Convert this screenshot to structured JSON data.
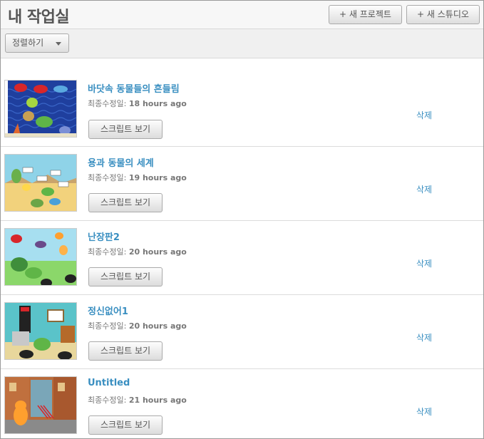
{
  "header": {
    "title": "내 작업실",
    "new_project_label": "+ 새 프로젝트",
    "new_studio_label": "+ 새 스튜디오"
  },
  "toolbar": {
    "sort_label": "정렬하기"
  },
  "projects": [
    {
      "title": "바닷속 동물들의 흔들림",
      "modified_label": "최종수정일:",
      "modified_ago": "18 hours ago",
      "script_button": "스크립트 보기",
      "delete_label": "삭제",
      "thumb_icon": "underwater-scene"
    },
    {
      "title": "용과 동물의 세계",
      "modified_label": "최종수정일:",
      "modified_ago": "19 hours ago",
      "script_button": "스크립트 보기",
      "delete_label": "삭제",
      "thumb_icon": "beach-scene"
    },
    {
      "title": "난장판2",
      "modified_label": "최종수정일:",
      "modified_ago": "20 hours ago",
      "script_button": "스크립트 보기",
      "delete_label": "삭제",
      "thumb_icon": "meadow-scene"
    },
    {
      "title": "정신없어1",
      "modified_label": "최종수정일:",
      "modified_ago": "20 hours ago",
      "script_button": "스크립트 보기",
      "delete_label": "삭제",
      "thumb_icon": "room-scene"
    },
    {
      "title": "Untitled",
      "modified_label": "최종수정일:",
      "modified_ago": "21 hours ago",
      "script_button": "스크립트 보기",
      "delete_label": "삭제",
      "thumb_icon": "street-scene"
    }
  ],
  "colors": {
    "link": "#3a8fc1",
    "header_bg": "#f7f7f7",
    "toolbar_bg": "#f0f0f0"
  }
}
